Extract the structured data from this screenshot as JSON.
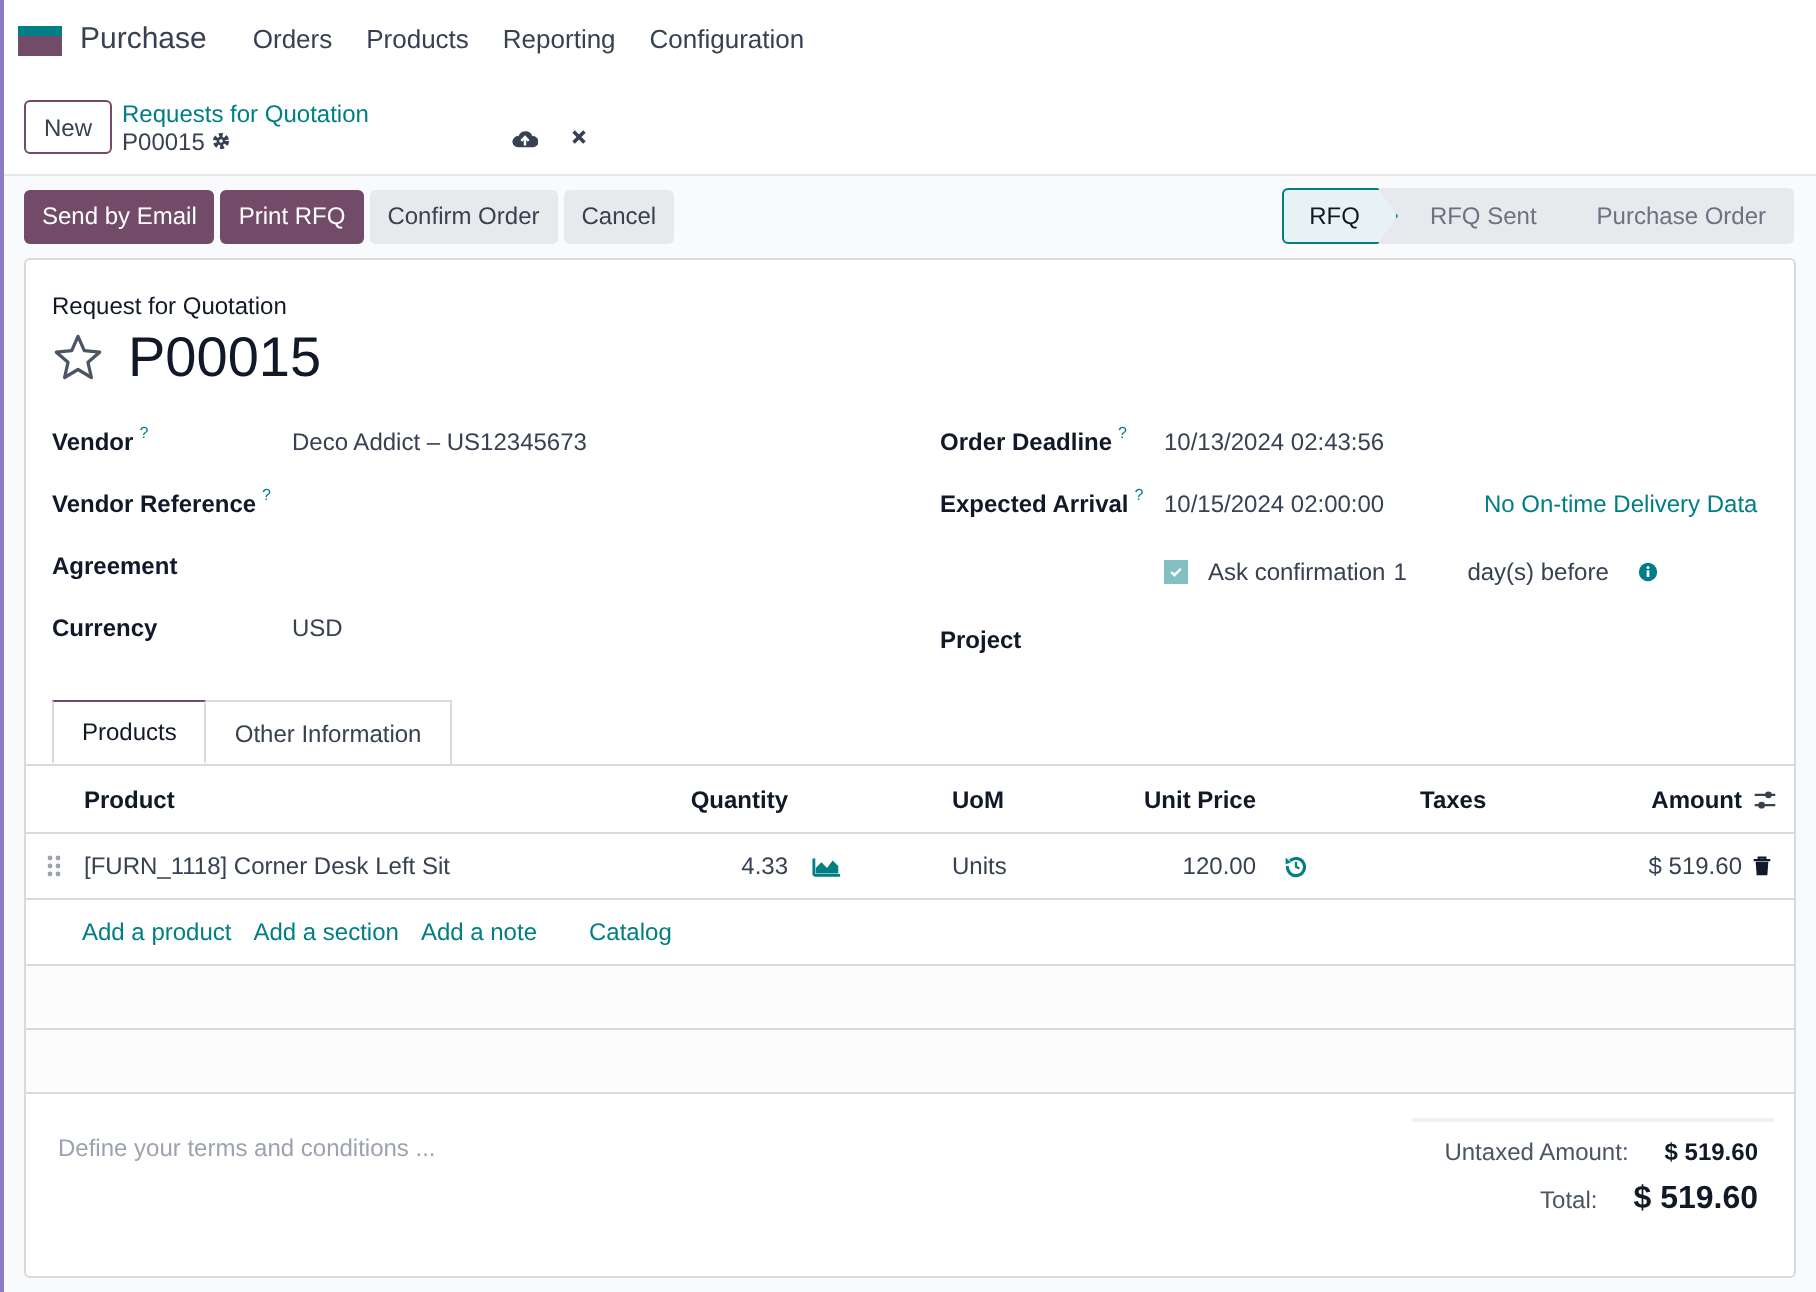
{
  "app": {
    "name": "Purchase",
    "menu": [
      "Orders",
      "Products",
      "Reporting",
      "Configuration"
    ]
  },
  "breadcrumb": {
    "new_button": "New",
    "parent": "Requests for Quotation",
    "current": "P00015"
  },
  "actions": [
    {
      "label": "Send by Email",
      "primary": true
    },
    {
      "label": "Print RFQ",
      "primary": true
    },
    {
      "label": "Confirm Order",
      "primary": false
    },
    {
      "label": "Cancel",
      "primary": false
    }
  ],
  "statusbar": [
    {
      "label": "RFQ",
      "selected": true
    },
    {
      "label": "RFQ Sent",
      "selected": false
    },
    {
      "label": "Purchase Order",
      "selected": false
    }
  ],
  "form": {
    "subtitle": "Request for Quotation",
    "name": "P00015",
    "starred": false,
    "left_fields": [
      {
        "label": "Vendor",
        "help": "?",
        "value": "Deco Addict – US12345673"
      },
      {
        "label": "Vendor Reference",
        "help": "?"
      },
      {
        "label": "Agreement"
      },
      {
        "label": "Currency",
        "value": "USD"
      }
    ],
    "right_fields": [
      {
        "kind": "field",
        "label": "Order Deadline",
        "help": "?",
        "value": "10/13/2024 02:43:56"
      },
      {
        "kind": "field",
        "label": "Expected Arrival",
        "help": "?",
        "value": "10/15/2024 02:00:00",
        "link": "No On-time Delivery Data"
      },
      {
        "kind": "checkbox",
        "checked": true,
        "label": "Ask confirmation",
        "days": "1",
        "suffix": "day(s) before"
      },
      {
        "kind": "field",
        "label": "Project"
      }
    ]
  },
  "tabs": [
    {
      "label": "Products",
      "selected": true
    },
    {
      "label": "Other Information",
      "selected": false
    }
  ],
  "table": {
    "columns": [
      "Product",
      "Quantity",
      "UoM",
      "Unit Price",
      "Taxes",
      "Amount"
    ],
    "rows": [
      {
        "product": "[FURN_1118] Corner Desk Left Sit",
        "quantity": "4.33",
        "uom": "Units",
        "unit_price": "120.00",
        "amount": "$ 519.60"
      }
    ],
    "add_links": [
      "Add a product",
      "Add a section",
      "Add a note",
      "Catalog"
    ]
  },
  "terms": {
    "placeholder": "Define your terms and conditions ..."
  },
  "totals": [
    {
      "label": "Untaxed Amount:",
      "value": "$ 519.60",
      "grand": false
    },
    {
      "label": "Total:",
      "value": "$ 519.60",
      "grand": true
    }
  ]
}
